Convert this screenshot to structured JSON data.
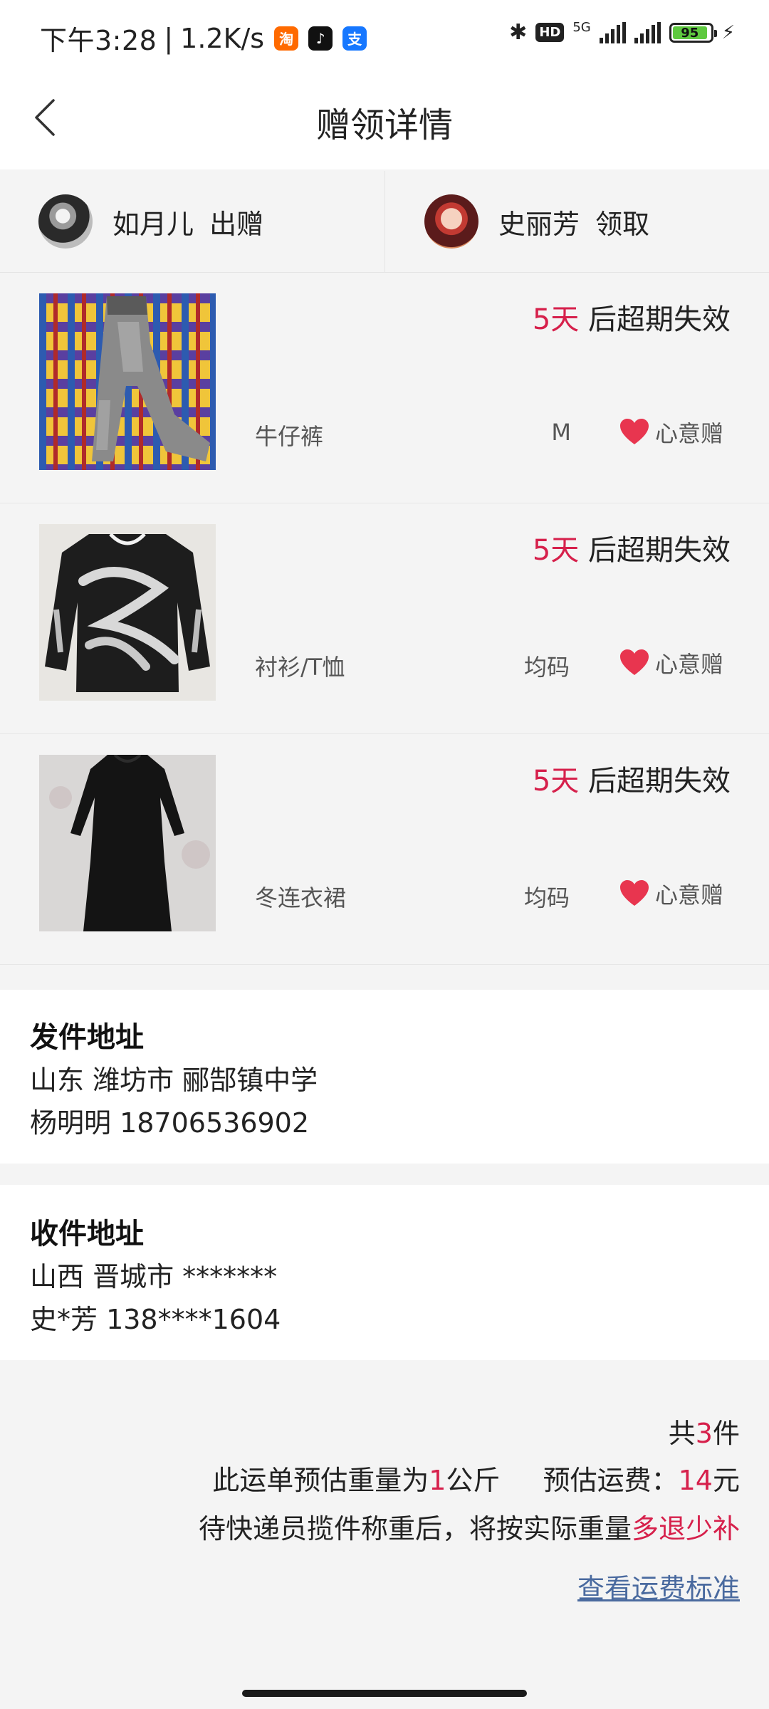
{
  "status_bar": {
    "time": "下午3:28",
    "network_speed": "1.2K/s",
    "network_type": "5G",
    "battery": "95",
    "app_icons": [
      "taobao-icon",
      "douyin-icon",
      "alipay-icon"
    ]
  },
  "nav": {
    "title": "赠领详情"
  },
  "parties": {
    "giver": {
      "name": "如月儿",
      "action": "出赠"
    },
    "receiver": {
      "name": "史丽芳",
      "action": "领取"
    }
  },
  "items": [
    {
      "days": "5天",
      "expiry_suffix": "后超期失效",
      "category": "牛仔裤",
      "size": "M",
      "gift_label": "心意赠",
      "image": "jeans-photo"
    },
    {
      "days": "5天",
      "expiry_suffix": "后超期失效",
      "category": "衬衫/T恤",
      "size": "均码",
      "gift_label": "心意赠",
      "image": "shirt-photo"
    },
    {
      "days": "5天",
      "expiry_suffix": "后超期失效",
      "category": "冬连衣裙",
      "size": "均码",
      "gift_label": "心意赠",
      "image": "dress-photo"
    }
  ],
  "send_address": {
    "title": "发件地址",
    "line1": "山东 潍坊市 郦郜镇中学",
    "line2": "杨明明 18706536902"
  },
  "receive_address": {
    "title": "收件地址",
    "line1": "山西 晋城市 *******",
    "line2": "史*芳 138****1604"
  },
  "summary": {
    "total_prefix": "共",
    "total_count": "3",
    "total_suffix": "件",
    "weight_prefix": "此运单预估重量为",
    "weight_value": "1",
    "weight_unit": "公斤",
    "fee_label": "预估运费：",
    "fee_value": "14",
    "fee_unit": "元",
    "note_prefix": "待快递员揽件称重后，将按实际重量",
    "note_highlight": "多退少补",
    "link_text": "查看运费标准"
  },
  "colors": {
    "accent_red": "#d6204b",
    "link_blue": "#4a6a9f",
    "heart": "#e8354f"
  }
}
